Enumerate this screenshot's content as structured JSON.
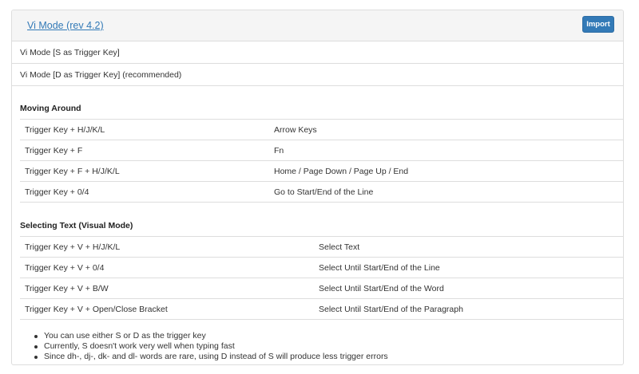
{
  "header": {
    "title": "Vi Mode (rev 4.2)",
    "import_label": "Import"
  },
  "options": [
    {
      "label": "Vi Mode [S as Trigger Key]"
    },
    {
      "label": "Vi Mode [D as Trigger Key] (recommended)"
    }
  ],
  "sections": [
    {
      "title": "Moving Around",
      "rows": [
        {
          "keys": "Trigger Key + H/J/K/L",
          "action": "Arrow Keys"
        },
        {
          "keys": "Trigger Key + F",
          "action": "Fn"
        },
        {
          "keys": "Trigger Key + F + H/J/K/L",
          "action": "Home / Page Down / Page Up / End"
        },
        {
          "keys": "Trigger Key + 0/4",
          "action": "Go to Start/End of the Line"
        }
      ]
    },
    {
      "title": "Selecting Text (Visual Mode)",
      "rows": [
        {
          "keys": "Trigger Key + V + H/J/K/L",
          "action": "Select Text"
        },
        {
          "keys": "Trigger Key + V + 0/4",
          "action": "Select Until Start/End of the Line"
        },
        {
          "keys": "Trigger Key + V + B/W",
          "action": "Select Until Start/End of the Word"
        },
        {
          "keys": "Trigger Key + V + Open/Close Bracket",
          "action": "Select Until Start/End of the Paragraph"
        }
      ]
    }
  ],
  "notes": [
    "You can use either S or D as the trigger key",
    "Currently, S doesn't work very well when typing fast",
    "Since dh-, dj-, dk- and dl- words are rare, using D instead of S will produce less trigger errors"
  ]
}
